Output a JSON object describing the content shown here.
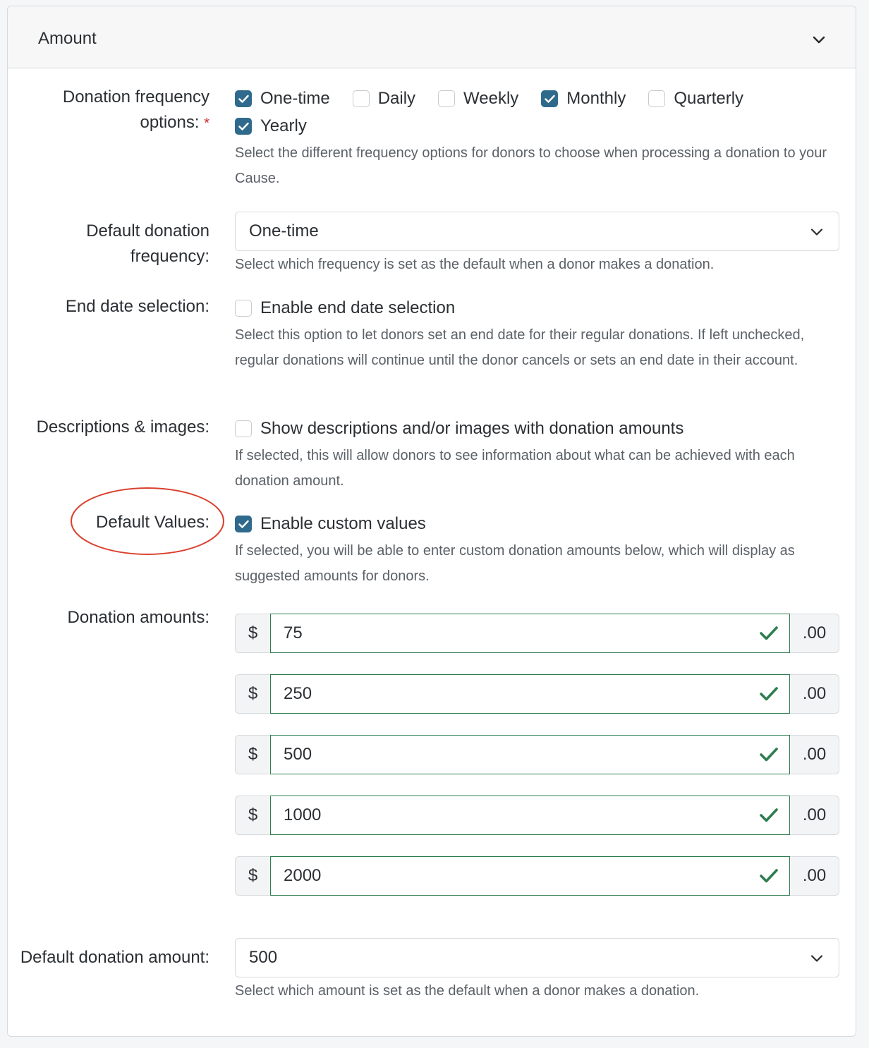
{
  "panel": {
    "title": "Amount"
  },
  "frequency_options": {
    "label": "Donation frequency options:",
    "required_mark": "*",
    "options": [
      {
        "label": "One-time",
        "checked": true
      },
      {
        "label": "Daily",
        "checked": false
      },
      {
        "label": "Weekly",
        "checked": false
      },
      {
        "label": "Monthly",
        "checked": true
      },
      {
        "label": "Quarterly",
        "checked": false
      },
      {
        "label": "Yearly",
        "checked": true
      }
    ],
    "help": "Select the different frequency options for donors to choose when processing a donation to your Cause."
  },
  "default_frequency": {
    "label": "Default donation frequency:",
    "value": "One-time",
    "help": "Select which frequency is set as the default when a donor makes a donation."
  },
  "end_date": {
    "label": "End date selection:",
    "checkbox_label": "Enable end date selection",
    "checked": false,
    "help": "Select this option to let donors set an end date for their regular donations. If left unchecked, regular donations will continue until the donor cancels or sets an end date in their account."
  },
  "descriptions": {
    "label": "Descriptions & images:",
    "checkbox_label": "Show descriptions and/or images with donation amounts",
    "checked": false,
    "help": "If selected, this will allow donors to see information about what can be achieved with each donation amount."
  },
  "default_values": {
    "label": "Default Values:",
    "checkbox_label": "Enable custom values",
    "checked": true,
    "help": "If selected, you will be able to enter custom donation amounts below, which will display as suggested amounts for donors."
  },
  "donation_amounts": {
    "label": "Donation amounts:",
    "currency_prefix": "$",
    "suffix": ".00",
    "amounts": [
      "75",
      "250",
      "500",
      "1000",
      "2000"
    ]
  },
  "default_amount": {
    "label": "Default donation amount:",
    "value": "500",
    "help": "Select which amount is set as the default when a donor makes a donation."
  },
  "colors": {
    "accent": "#2f6a8c",
    "valid": "#2e7d4f",
    "annotation": "#d9412e",
    "required": "#c9302c"
  }
}
